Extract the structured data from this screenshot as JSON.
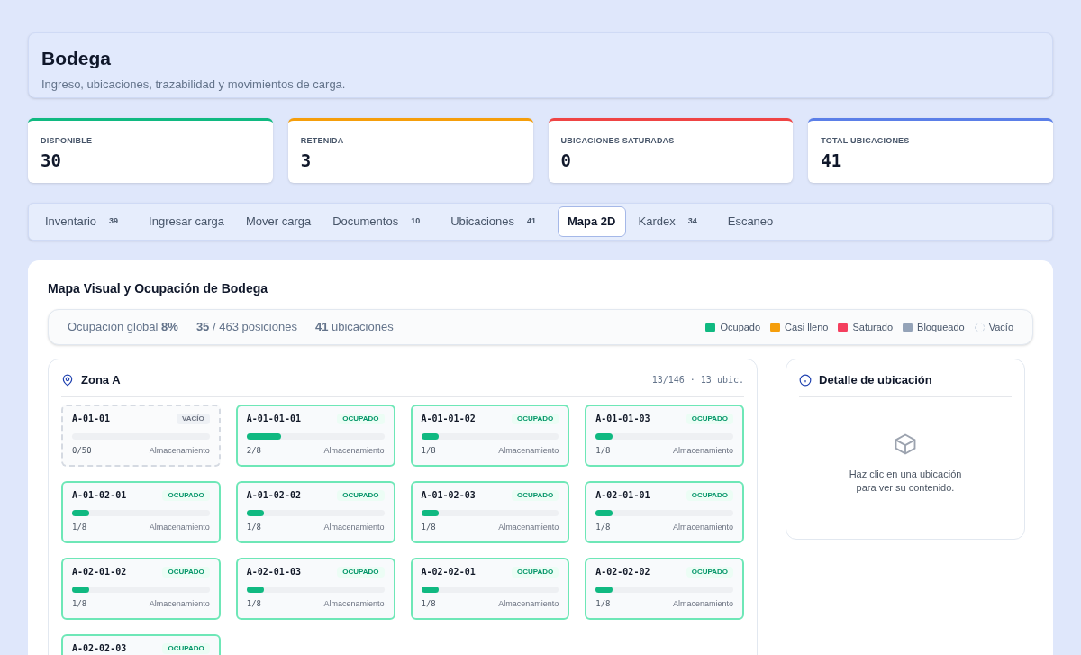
{
  "header": {
    "title": "Bodega",
    "subtitle": "Ingreso, ubicaciones, trazabilidad y movimientos de carga."
  },
  "stats": [
    {
      "label": "DISPONIBLE",
      "value": "30",
      "color": "#10b981"
    },
    {
      "label": "RETENIDA",
      "value": "3",
      "color": "#f59e0b"
    },
    {
      "label": "UBICACIONES SATURADAS",
      "value": "0",
      "color": "#ef4444"
    },
    {
      "label": "TOTAL UBICACIONES",
      "value": "41",
      "color": "#5b7fe8"
    }
  ],
  "tabs": [
    {
      "label": "Inventario",
      "count": "39",
      "selected": false
    },
    {
      "label": "Ingresar carga",
      "selected": false
    },
    {
      "label": "Mover carga",
      "selected": false
    },
    {
      "label": "Documentos",
      "count": "10",
      "selected": false
    },
    {
      "label": "Ubicaciones",
      "count": "41",
      "selected": false
    },
    {
      "label": "Mapa 2D",
      "selected": true
    },
    {
      "label": "Kardex",
      "count": "34",
      "selected": false
    },
    {
      "label": "Escaneo",
      "selected": false
    }
  ],
  "map": {
    "title": "Mapa Visual y Ocupación de Bodega",
    "summary": {
      "occupancy": "Ocupación global **8%**",
      "positions": "**35** / 463 posiciones",
      "locations": "**41** ubicaciones"
    },
    "legend": [
      {
        "label": "Ocupado",
        "color": "#10b981"
      },
      {
        "label": "Casi lleno",
        "color": "#f59e0b"
      },
      {
        "label": "Saturado",
        "color": "#f43f5e"
      },
      {
        "label": "Bloqueado",
        "color": "#94a3b8"
      },
      {
        "label": "Vacío",
        "kind": "empty"
      }
    ],
    "zone": {
      "name": "Zona A",
      "stats": "13/146 · 13 ubic.",
      "cells": [
        {
          "id": "A-01-01",
          "status": "VACÍO",
          "kind": "empty",
          "reading": "0/50",
          "type": "Almacenamiento"
        },
        {
          "id": "A-01-01-01",
          "status": "OCUPADO",
          "kind": "occupied",
          "level": 0.25,
          "reading": "2/8",
          "type": "Almacenamiento"
        },
        {
          "id": "A-01-01-02",
          "status": "OCUPADO",
          "kind": "occupied",
          "level": 0.125,
          "reading": "1/8",
          "type": "Almacenamiento"
        },
        {
          "id": "A-01-01-03",
          "status": "OCUPADO",
          "kind": "occupied",
          "level": 0.125,
          "reading": "1/8",
          "type": "Almacenamiento"
        },
        {
          "id": "A-01-02-01",
          "status": "OCUPADO",
          "kind": "occupied",
          "level": 0.125,
          "reading": "1/8",
          "type": "Almacenamiento"
        },
        {
          "id": "A-01-02-02",
          "status": "OCUPADO",
          "kind": "occupied",
          "level": 0.125,
          "reading": "1/8",
          "type": "Almacenamiento"
        },
        {
          "id": "A-01-02-03",
          "status": "OCUPADO",
          "kind": "occupied",
          "level": 0.125,
          "reading": "1/8",
          "type": "Almacenamiento"
        },
        {
          "id": "A-02-01-01",
          "status": "OCUPADO",
          "kind": "occupied",
          "level": 0.125,
          "reading": "1/8",
          "type": "Almacenamiento"
        },
        {
          "id": "A-02-01-02",
          "status": "OCUPADO",
          "kind": "occupied",
          "level": 0.125,
          "reading": "1/8",
          "type": "Almacenamiento"
        },
        {
          "id": "A-02-01-03",
          "status": "OCUPADO",
          "kind": "occupied",
          "level": 0.125,
          "reading": "1/8",
          "type": "Almacenamiento"
        },
        {
          "id": "A-02-02-01",
          "status": "OCUPADO",
          "kind": "occupied",
          "level": 0.125,
          "reading": "1/8",
          "type": "Almacenamiento"
        },
        {
          "id": "A-02-02-02",
          "status": "OCUPADO",
          "kind": "occupied",
          "level": 0.125,
          "reading": "1/8",
          "type": "Almacenamiento"
        },
        {
          "id": "A-02-02-03",
          "status": "OCUPADO",
          "kind": "occupied"
        }
      ]
    },
    "detail": {
      "title": "Detalle de ubicación",
      "hint": "Haz clic en una ubicación para ver su contenido."
    }
  }
}
